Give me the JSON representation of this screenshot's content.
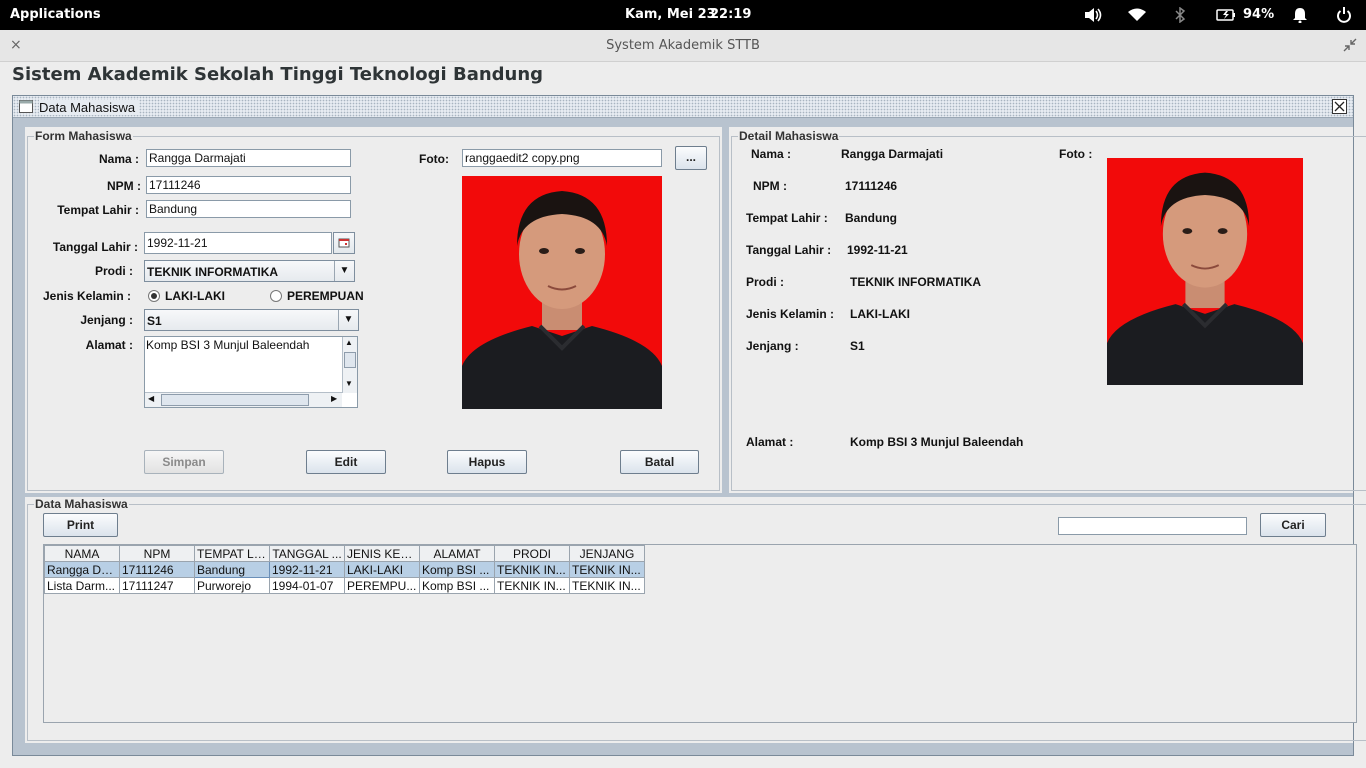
{
  "system_bar": {
    "applications": "Applications",
    "datetime": "Kam, Mei 23",
    "time": "22:19",
    "battery": "94%",
    "icons": [
      "volume-icon",
      "wifi-icon",
      "bluetooth-icon",
      "battery-icon",
      "notification-bell-icon",
      "power-icon"
    ]
  },
  "window": {
    "title": "System Akademik STTB",
    "close": "×"
  },
  "app_title": "Sistem Akademik Sekolah Tinggi Teknologi Bandung",
  "internal_frame": {
    "title": "Data Mahasiswa"
  },
  "form": {
    "legend": "Form Mahasiswa",
    "nama_label": "Nama :",
    "nama_value": "Rangga Darmajati",
    "npm_label": "NPM :",
    "npm_value": "17111246",
    "tempat_label": "Tempat Lahir :",
    "tempat_value": "Bandung",
    "tanggal_label": "Tanggal Lahir :",
    "tanggal_value": "1992-11-21",
    "prodi_label": "Prodi :",
    "prodi_value": "TEKNIK INFORMATIKA",
    "jk_label": "Jenis Kelamin :",
    "jk_options": [
      "LAKI-LAKI",
      "PEREMPUAN"
    ],
    "jk_selected": "LAKI-LAKI",
    "jenjang_label": "Jenjang :",
    "jenjang_value": "S1",
    "alamat_label": "Alamat :",
    "alamat_value": "Komp BSI 3 Munjul Baleendah",
    "foto_label": "Foto:",
    "foto_value": "ranggaedit2 copy.png",
    "browse_label": "...",
    "buttons": {
      "simpan": "Simpan",
      "edit": "Edit",
      "hapus": "Hapus",
      "batal": "Batal"
    }
  },
  "detail": {
    "legend": "Detail Mahasiswa",
    "nama_label": "Nama :",
    "nama_value": "Rangga Darmajati",
    "foto_label": "Foto :",
    "npm_label": "NPM :",
    "npm_value": "17111246",
    "tempat_label": "Tempat Lahir :",
    "tempat_value": "Bandung",
    "tanggal_label": "Tanggal Lahir :",
    "tanggal_value": "1992-11-21",
    "prodi_label": "Prodi :",
    "prodi_value": "TEKNIK INFORMATIKA",
    "jk_label": "Jenis Kelamin :",
    "jk_value": "LAKI-LAKI",
    "jenjang_label": "Jenjang :",
    "jenjang_value": "S1",
    "alamat_label": "Alamat :",
    "alamat_value": "Komp BSI 3 Munjul Baleendah"
  },
  "data_panel": {
    "legend": "Data Mahasiswa",
    "print_label": "Print",
    "search_value": "",
    "cari_label": "Cari",
    "columns": [
      "NAMA",
      "NPM",
      "TEMPAT LA...",
      "TANGGAL ...",
      "JENIS KEL...",
      "ALAMAT",
      "PRODI",
      "JENJANG"
    ],
    "rows": [
      [
        "Rangga Da...",
        "17111246",
        "Bandung",
        "1992-11-21",
        "LAKI-LAKI",
        "Komp BSI ...",
        "TEKNIK IN...",
        "TEKNIK IN..."
      ],
      [
        "Lista Darm...",
        "17111247",
        "Purworejo",
        "1994-01-07",
        "PEREMPU...",
        "Komp BSI ...",
        "TEKNIK IN...",
        "TEKNIK IN..."
      ]
    ],
    "selected_row": 0
  },
  "colors": {
    "photo_background": "#f20a0a",
    "selection": "#b8cfe5"
  }
}
